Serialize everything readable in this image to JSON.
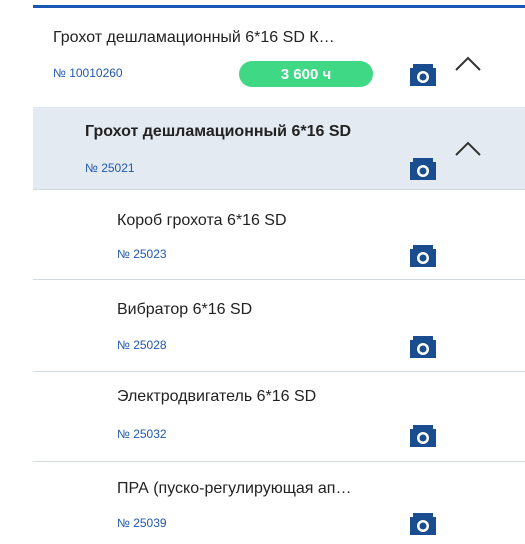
{
  "items": [
    {
      "title": "Грохот дешламационный 6*16 SD К…",
      "number": "№ 10010260",
      "badge": "3 600 ч",
      "icon": "camera-icon",
      "toggle": "chevron-up-icon"
    },
    {
      "title": "Грохот дешламационный 6*16 SD",
      "number": "№ 25021",
      "icon": "camera-icon",
      "toggle": "chevron-up-icon",
      "selected": true
    },
    {
      "title": "Короб грохота 6*16 SD",
      "number": "№ 25023",
      "icon": "camera-icon"
    },
    {
      "title": "Вибратор 6*16 SD",
      "number": "№ 25028",
      "icon": "camera-icon"
    },
    {
      "title": "Электродвигатель 6*16 SD",
      "number": "№ 25032",
      "icon": "camera-icon"
    },
    {
      "title": "ПРА (пуско-регулирующая ап…",
      "number": "№ 25039",
      "icon": "camera-icon"
    }
  ],
  "colors": {
    "accent": "#1a56b4",
    "badge": "#3fd884",
    "selected_bg": "#e4eaf1",
    "number": "#1f58ad"
  }
}
